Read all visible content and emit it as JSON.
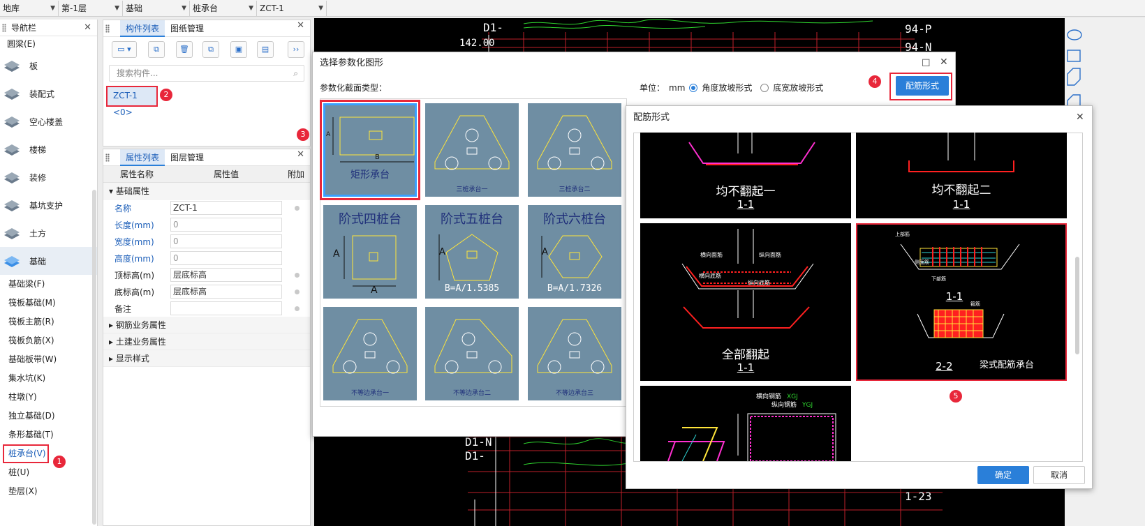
{
  "topbar": {
    "dropdowns": [
      "地库",
      "第-1层",
      "基础",
      "桩承台",
      "ZCT-1"
    ]
  },
  "nav": {
    "title": "导航栏",
    "pre_item": "圆梁(E)",
    "categories": [
      {
        "label": "板"
      },
      {
        "label": "装配式"
      },
      {
        "label": "空心楼盖"
      },
      {
        "label": "楼梯"
      },
      {
        "label": "装修"
      },
      {
        "label": "基坑支护"
      },
      {
        "label": "土方"
      },
      {
        "label": "基础"
      }
    ],
    "subitems": [
      "基础梁(F)",
      "筏板基础(M)",
      "筏板主筋(R)",
      "筏板负筋(X)",
      "基础板带(W)",
      "集水坑(K)",
      "柱墩(Y)",
      "独立基础(D)",
      "条形基础(T)",
      "桩承台(V)",
      "桩(U)",
      "垫层(X)"
    ]
  },
  "component_panel": {
    "tabs": [
      "构件列表",
      "图纸管理"
    ],
    "search_placeholder": "搜索构件...",
    "item": "ZCT-1 <0>"
  },
  "property_panel": {
    "tabs": [
      "属性列表",
      "图层管理"
    ],
    "headers": [
      "属性名称",
      "属性值",
      "附加"
    ],
    "group_basic": "基础属性",
    "rows": [
      {
        "k": "名称",
        "v": "ZCT-1"
      },
      {
        "k": "长度(mm)",
        "v": "0"
      },
      {
        "k": "宽度(mm)",
        "v": "0"
      },
      {
        "k": "高度(mm)",
        "v": "0"
      },
      {
        "k": "顶标高(m)",
        "v": "层底标高"
      },
      {
        "k": "底标高(m)",
        "v": "层底标高"
      },
      {
        "k": "备注",
        "v": ""
      }
    ],
    "groups_more": [
      "钢筋业务属性",
      "土建业务属性",
      "显示样式"
    ]
  },
  "dialog_shape": {
    "title": "选择参数化图形",
    "section_label": "参数化截面类型：",
    "unit_label": "单位：",
    "unit": "mm",
    "radio1": "角度放坡形式",
    "radio2": "底宽放坡形式",
    "button": "配筋形式",
    "tiles": [
      "矩形承台",
      "三桩承台一",
      "三桩承台二",
      "阶式四桩台",
      "阶式五桩台",
      "阶式六桩台",
      "不等边承台一",
      "不等边承台二",
      "不等边承台三"
    ],
    "tile_formulas": [
      "B=A/1.5385",
      "B=A/1.7326"
    ],
    "dim_a": "A",
    "dim_b": "B"
  },
  "dialog_rebar": {
    "title": "配筋形式",
    "ok": "确定",
    "cancel": "取消",
    "panes": [
      {
        "caption": "均不翻起一",
        "section": "1-1"
      },
      {
        "caption": "均不翻起二",
        "section": "1-1"
      },
      {
        "caption": "全部翻起",
        "section": "1-1"
      },
      {
        "caption": "梁式配筋承台",
        "section": "1-1",
        "section2": "2-2"
      }
    ],
    "pane5_labels": [
      "横向钢筋",
      "XGJ",
      "纵向钢筋",
      "YGJ"
    ],
    "pane3_labels": [
      "横向面筋",
      "纵向面筋",
      "横向底筋",
      "纵向底筋"
    ],
    "pane4_labels": [
      "上部筋",
      "侧面筋",
      "下部筋",
      "箍筋"
    ]
  },
  "badges": [
    "1",
    "2",
    "3",
    "4",
    "5"
  ],
  "cad": {
    "labels": [
      "D1-",
      "142.00",
      "94-P",
      "94-N",
      "D1-N",
      "D1-",
      "1-23"
    ]
  }
}
